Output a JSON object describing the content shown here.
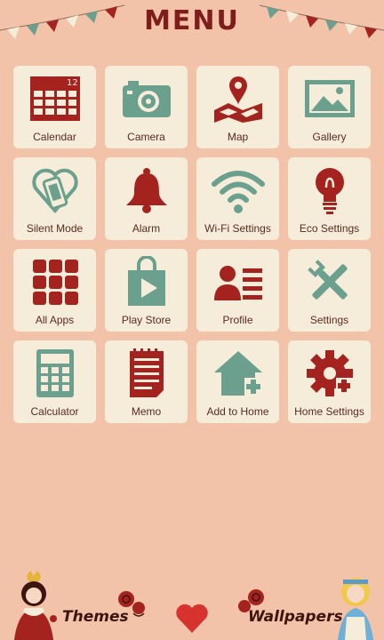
{
  "header": {
    "title": "MENU"
  },
  "tiles": [
    {
      "label": "Calendar",
      "icon": "calendar-icon",
      "badge": "12"
    },
    {
      "label": "Camera",
      "icon": "camera-icon"
    },
    {
      "label": "Map",
      "icon": "map-icon"
    },
    {
      "label": "Gallery",
      "icon": "gallery-icon"
    },
    {
      "label": "Silent Mode",
      "icon": "silent-mode-icon"
    },
    {
      "label": "Alarm",
      "icon": "bell-icon"
    },
    {
      "label": "Wi-Fi Settings",
      "icon": "wifi-icon"
    },
    {
      "label": "Eco Settings",
      "icon": "lightbulb-icon"
    },
    {
      "label": "All Apps",
      "icon": "apps-grid-icon"
    },
    {
      "label": "Play Store",
      "icon": "play-store-icon"
    },
    {
      "label": "Profile",
      "icon": "profile-icon"
    },
    {
      "label": "Settings",
      "icon": "tools-icon"
    },
    {
      "label": "Calculator",
      "icon": "calculator-icon"
    },
    {
      "label": "Memo",
      "icon": "memo-icon"
    },
    {
      "label": "Add to Home",
      "icon": "add-home-icon"
    },
    {
      "label": "Home Settings",
      "icon": "gear-icon"
    }
  ],
  "footer": {
    "themes_label": "Themes",
    "wallpapers_label": "Wallpapers"
  },
  "colors": {
    "background": "#f2c3a9",
    "tile": "#f5ecd9",
    "red": "#a5231f",
    "green": "#6b9f8e",
    "dark": "#7e1d1c"
  }
}
